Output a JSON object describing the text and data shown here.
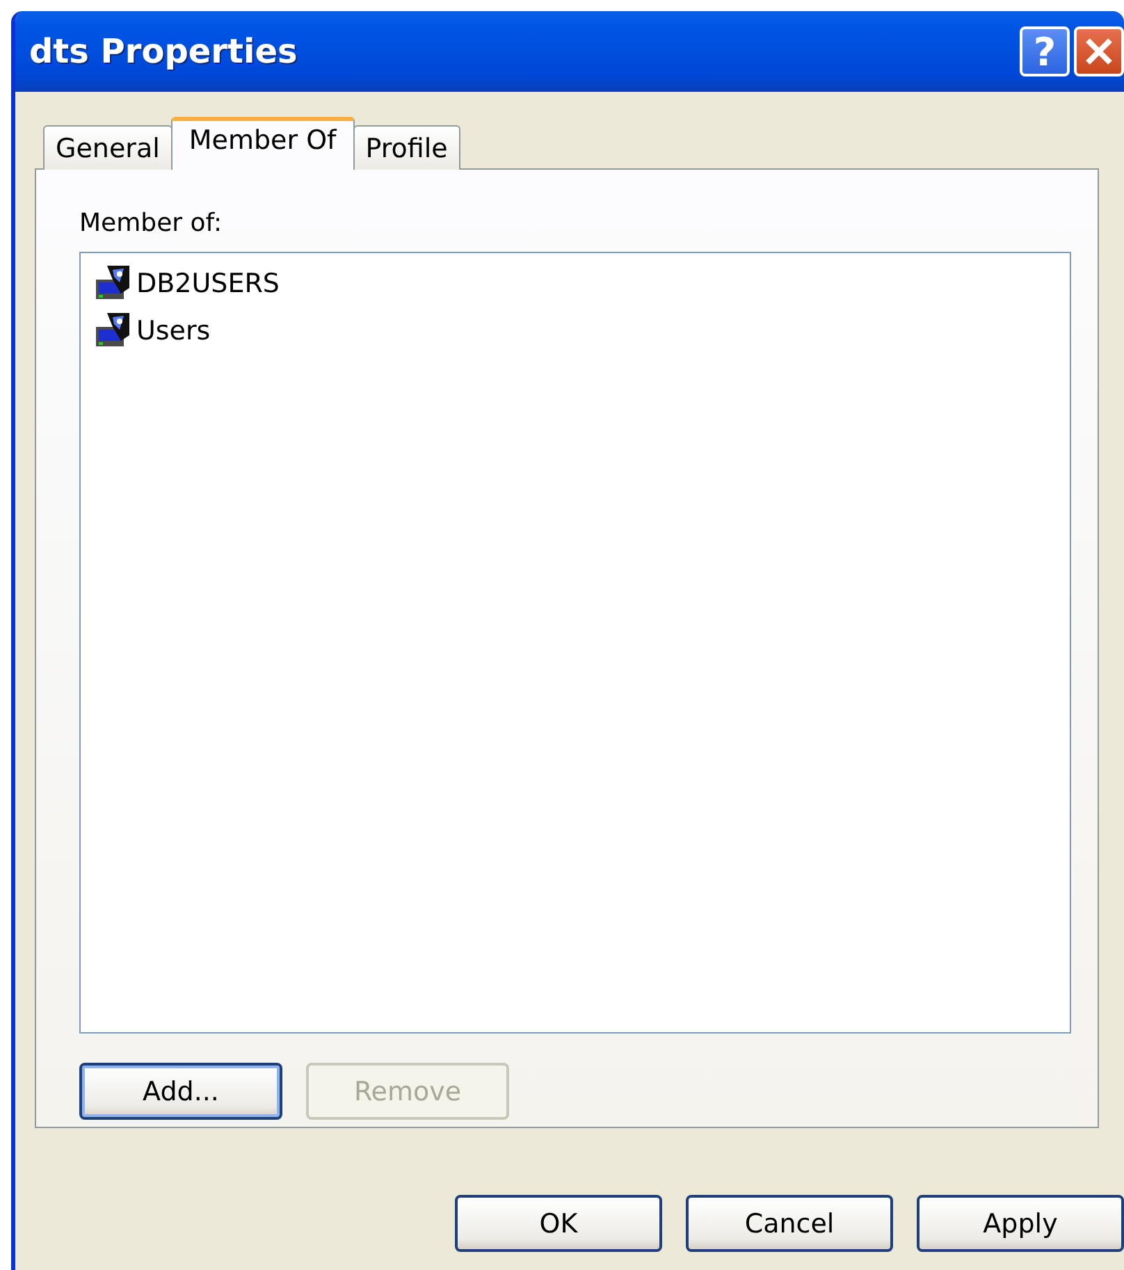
{
  "window": {
    "title": "dts Properties",
    "help_button": "?"
  },
  "tabs": [
    {
      "label": "General",
      "selected": false
    },
    {
      "label": "Member Of",
      "selected": true
    },
    {
      "label": "Profile",
      "selected": false
    }
  ],
  "member_of": {
    "label": "Member of:",
    "items": [
      {
        "name": "DB2USERS"
      },
      {
        "name": "Users"
      }
    ]
  },
  "list_buttons": [
    {
      "label": "Add...",
      "disabled": false,
      "focused": true
    },
    {
      "label": "Remove",
      "disabled": true,
      "focused": false
    }
  ],
  "dialog_buttons": [
    {
      "label": "OK",
      "disabled": false,
      "focused": false
    },
    {
      "label": "Cancel",
      "disabled": false,
      "focused": false
    },
    {
      "label": "Apply",
      "disabled": false,
      "focused": false
    }
  ]
}
